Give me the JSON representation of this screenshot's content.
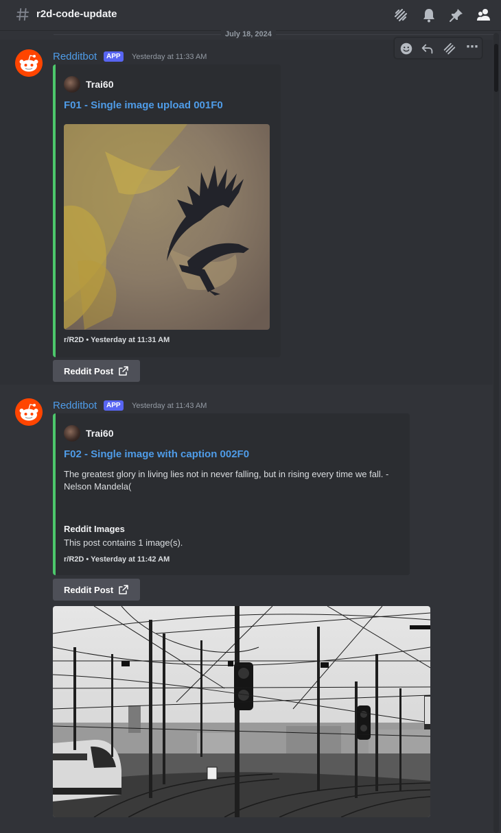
{
  "header": {
    "channel": "r2d-code-update",
    "icons": [
      "threads-icon",
      "bell-icon",
      "pin-icon",
      "members-icon"
    ]
  },
  "date_divider": "July 18, 2024",
  "toolbar": {
    "icons": [
      "add-reaction-icon",
      "reply-icon",
      "create-thread-icon",
      "more-icon"
    ],
    "more_label": "⋯"
  },
  "messages": [
    {
      "author": "Redditbot",
      "badge": "APP",
      "timestamp": "Yesterday at 11:33 AM",
      "embed": {
        "author": "Trai60",
        "title": "F01 - Single image upload 001F0",
        "footer": "r/R2D • Yesterday at 11:31 AM"
      },
      "button": "Reddit Post"
    },
    {
      "author": "Redditbot",
      "badge": "APP",
      "timestamp": "Yesterday at 11:43 AM",
      "embed": {
        "author": "Trai60",
        "title": "F02 - Single image with caption 002F0",
        "description": "The greatest glory in living lies not in never falling, but in rising every time we fall. - Nelson Mandela(",
        "field_name": "Reddit Images",
        "field_value": "This post contains 1 image(s).",
        "footer": "r/R2D • Yesterday at 11:42 AM"
      },
      "button": "Reddit Post"
    }
  ],
  "colors": {
    "background": "#313338",
    "embed_bg": "#2b2d31",
    "embed_accent": "#4cc76b",
    "link": "#4f9ce8",
    "badge": "#5865f2",
    "reddit": "#ff4500"
  }
}
